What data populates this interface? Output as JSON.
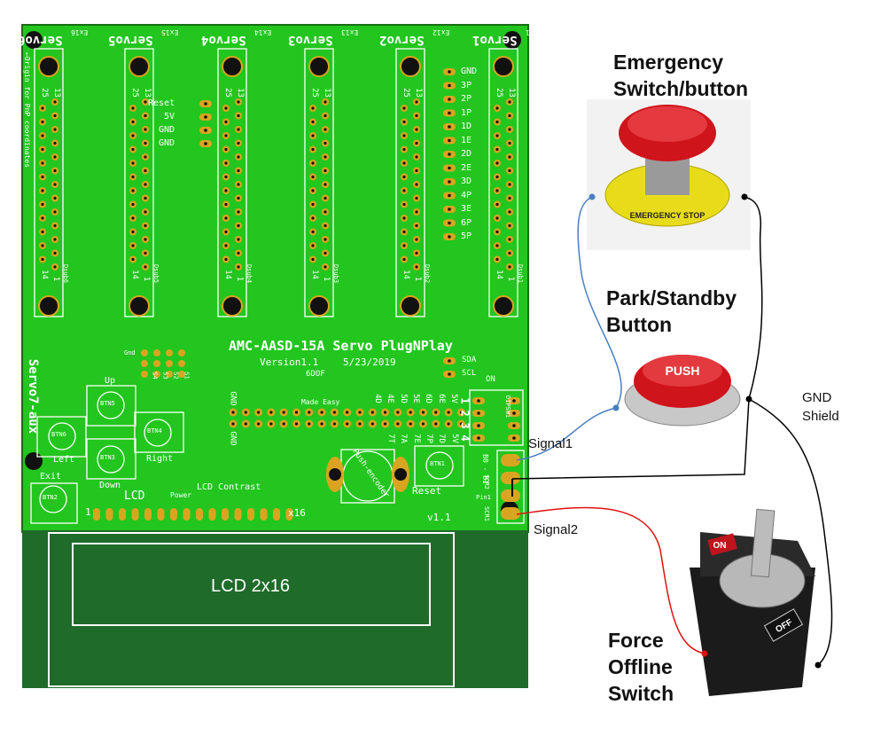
{
  "board": {
    "title": "AMC-AASD-15A Servo PlugNPlay",
    "version": "Version1.1",
    "date": "5/23/2019",
    "logo_top": "6DOF",
    "logo_bottom": "Made Easy",
    "servo_labels": [
      "Servo6",
      "Servo5",
      "Servo4",
      "Servo3",
      "Servo2",
      "Servo1"
    ],
    "ex_labels": [
      "Ex16",
      "Ex15",
      "Ex14",
      "Ex13",
      "Ex12",
      "Ex11"
    ],
    "dsub_labels": [
      "Dsub6",
      "Dsub5",
      "Dsub4",
      "Dsub3",
      "Dsub2",
      "Dsub1"
    ],
    "pin_numbers": {
      "top_a": "13",
      "top_b": "25",
      "bottom_a": "14",
      "bottom_b": "1"
    },
    "origin_note": "←Origin for PnP coordinates",
    "servo7": "Servo7-aux",
    "left_pins": [
      "Reset",
      "5V",
      "GND",
      "GND"
    ],
    "right_pins": [
      "GND",
      "3P",
      "2P",
      "1P",
      "1D",
      "1E",
      "2D",
      "2E",
      "3D",
      "4P",
      "3E",
      "6P",
      "5P"
    ],
    "i2c_pins": [
      "SDA",
      "SCL"
    ],
    "header_top": [
      "4D",
      "4E",
      "5D",
      "5E",
      "6D",
      "6E",
      "5V"
    ],
    "header_bottom": [
      "7T",
      "7A",
      "7E",
      "7P",
      "7D",
      "5V"
    ],
    "gnd_labels": [
      "GND",
      "GND"
    ],
    "dip": {
      "name": "DIPSW1",
      "on": "ON",
      "numbers": [
        "1",
        "2",
        "3",
        "4"
      ]
    },
    "buttons": {
      "up": "Up",
      "down": "Down",
      "left": "Left",
      "right": "Right",
      "exit": "Exit",
      "btn2": "BTN2",
      "btn3": "BTN3",
      "btn4": "BTN4",
      "btn5": "BTN5",
      "btn6": "BTN6",
      "btn1": "BTN1",
      "reset": "Reset"
    },
    "encoder": "Push-encoder",
    "lcd_contrast": "LCD Contrast",
    "power": "Power",
    "lcd_header": "LCD",
    "lcd_pin_start": "1",
    "lcd_pin_end": "x16",
    "v11": "v1.1",
    "scr": [
      "SCR2",
      "SCR1"
    ],
    "b_pins": "B0 - B1",
    "pin1": "Pin1",
    "switch_labels": [
      "S4",
      "S3",
      "S2",
      "S1"
    ],
    "gnd_s": "Gnd",
    "lcd_module": "LCD 2x16"
  },
  "annotations": {
    "emergency": "Emergency Switch/button",
    "park": "Park/Standby Button",
    "gnd_shield": "GND Shield",
    "signal1": "Signal1",
    "signal2": "Signal2",
    "force": "Force Offline Switch",
    "estop_text": "EMERGENCY STOP",
    "push_text": "PUSH",
    "on_text": "ON",
    "off_text": "OFF"
  },
  "colors": {
    "pcb": "#22c61e",
    "lcd_area": "#1f6b2a",
    "pad": "#d9a520",
    "wire_signal1": "#4a7fc0",
    "wire_gnd": "#000000",
    "wire_signal2": "#e01010"
  }
}
